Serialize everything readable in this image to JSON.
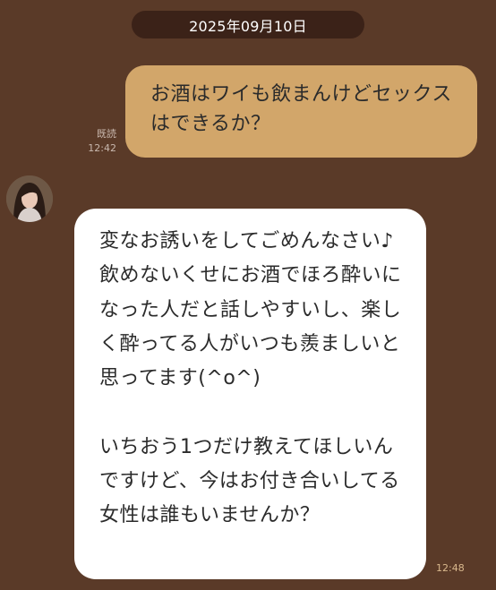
{
  "date_separator": "2025年09月10日",
  "outgoing_message": {
    "text": "お酒はワイも飲まんけどセックスはできるか？",
    "read_label": "既読",
    "time": "12:42"
  },
  "incoming_message": {
    "text": "変なお誘いをしてごめんなさい♪\n飲めないくせにお酒でほろ酔いになった人だと話しやすいし、楽しく酔ってる人がいつも羨ましいと思ってます(^o^)\n\nいちおう1つだけ教えてほしいんですけど、今はお付き合いしてる女性は誰もいませんか？",
    "time": "12:48"
  },
  "colors": {
    "background": "#5a3a28",
    "date_pill": "#3b2218",
    "outgoing_bubble": "#d2a66a",
    "incoming_bubble": "#ffffff",
    "timestamp": "#d9b88d"
  },
  "icons": {
    "avatar": "profile-photo-avatar"
  }
}
